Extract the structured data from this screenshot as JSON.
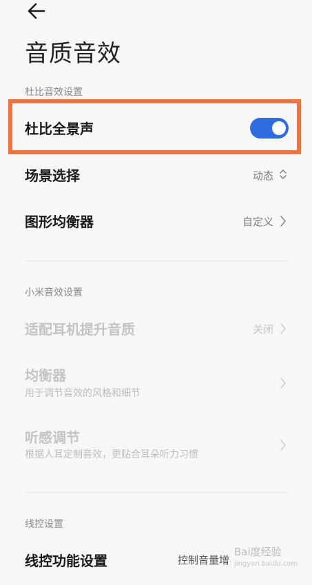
{
  "header": {
    "back_icon": "arrow-left-icon",
    "title": "音质音效"
  },
  "dolby": {
    "section_label": "杜比音效设置",
    "atmos_label": "杜比全景声",
    "atmos_enabled": true,
    "scene_label": "场景选择",
    "scene_value": "动态",
    "eq_label": "图形均衡器",
    "eq_value": "自定义"
  },
  "xiaomi": {
    "section_label": "小米音效设置",
    "headphone_label": "适配耳机提升音质",
    "headphone_value": "关闭",
    "equalizer_label": "均衡器",
    "equalizer_sub": "用于调节音效的风格和细节",
    "hearing_label": "听感调节",
    "hearing_sub": "根据人耳定制音效，更贴合耳朵听力习惯"
  },
  "wired": {
    "section_label": "线控设置",
    "function_label": "线控功能设置",
    "function_value": "控制音量增"
  },
  "colors": {
    "accent": "#2f6ce0",
    "highlight_border": "#ee7541",
    "background": "#f7f7f7"
  },
  "watermark": {
    "text": "Bai度经验",
    "url": "jingyan.baidu.com"
  }
}
